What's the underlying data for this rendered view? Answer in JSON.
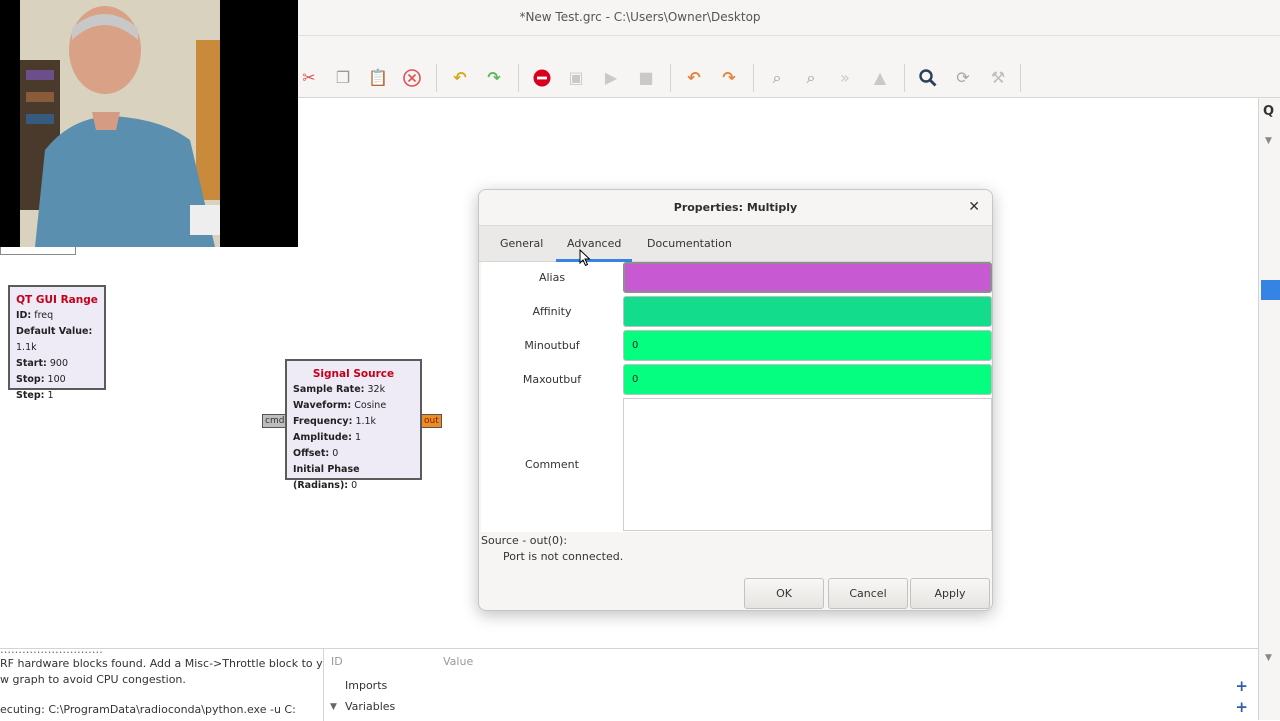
{
  "window": {
    "title": "*New Test.grc - C:\\Users\\Owner\\Desktop"
  },
  "right_panel": {
    "search_icon": "search-icon"
  },
  "blocks": {
    "qt_range": {
      "title": "QT GUI Range",
      "rows": [
        {
          "key": "ID:",
          "val": "freq"
        },
        {
          "key": "Default Value:",
          "val": "1.1k"
        },
        {
          "key": "Start:",
          "val": "900"
        },
        {
          "key": "Stop:",
          "val": "100"
        },
        {
          "key": "Step:",
          "val": "1"
        }
      ]
    },
    "signal_source": {
      "title": "Signal Source",
      "rows": [
        {
          "key": "Sample Rate:",
          "val": "32k"
        },
        {
          "key": "Waveform:",
          "val": "Cosine"
        },
        {
          "key": "Frequency:",
          "val": "1.1k"
        },
        {
          "key": "Amplitude:",
          "val": "1"
        },
        {
          "key": "Offset:",
          "val": "0"
        },
        {
          "key": "Initial Phase (Radians):",
          "val": "0"
        }
      ],
      "port_in": "cmd",
      "port_out": "out"
    }
  },
  "console": {
    "lines": [
      "RF hardware blocks found. Add a Misc->Throttle block to your",
      "w graph to avoid CPU congestion.",
      "ecuting: C:\\ProgramData\\radioconda\\python.exe -u C:"
    ]
  },
  "variables": {
    "col_id": "ID",
    "col_value": "Value",
    "imports": "Imports",
    "variables": "Variables"
  },
  "dialog": {
    "title": "Properties: Multiply",
    "tabs": [
      "General",
      "Advanced",
      "Documentation"
    ],
    "active_tab": "Advanced",
    "fields": {
      "alias": {
        "label": "Alias",
        "value": "",
        "color": "#c75ad2"
      },
      "affinity": {
        "label": "Affinity",
        "value": "",
        "color": "#13dc8c"
      },
      "minoutbuf": {
        "label": "Minoutbuf",
        "value": "0",
        "color": "#05fe7f"
      },
      "maxoutbuf": {
        "label": "Maxoutbuf",
        "value": "0",
        "color": "#05fe7f"
      },
      "comment": {
        "label": "Comment",
        "value": ""
      }
    },
    "info": {
      "line1": "Source - out(0):",
      "line2": "Port is not connected."
    },
    "buttons": {
      "ok": "OK",
      "cancel": "Cancel",
      "apply": "Apply"
    }
  },
  "colors": {
    "accent": "#3584e4",
    "block_title": "#c4001a",
    "port_out": "#f08a24"
  }
}
